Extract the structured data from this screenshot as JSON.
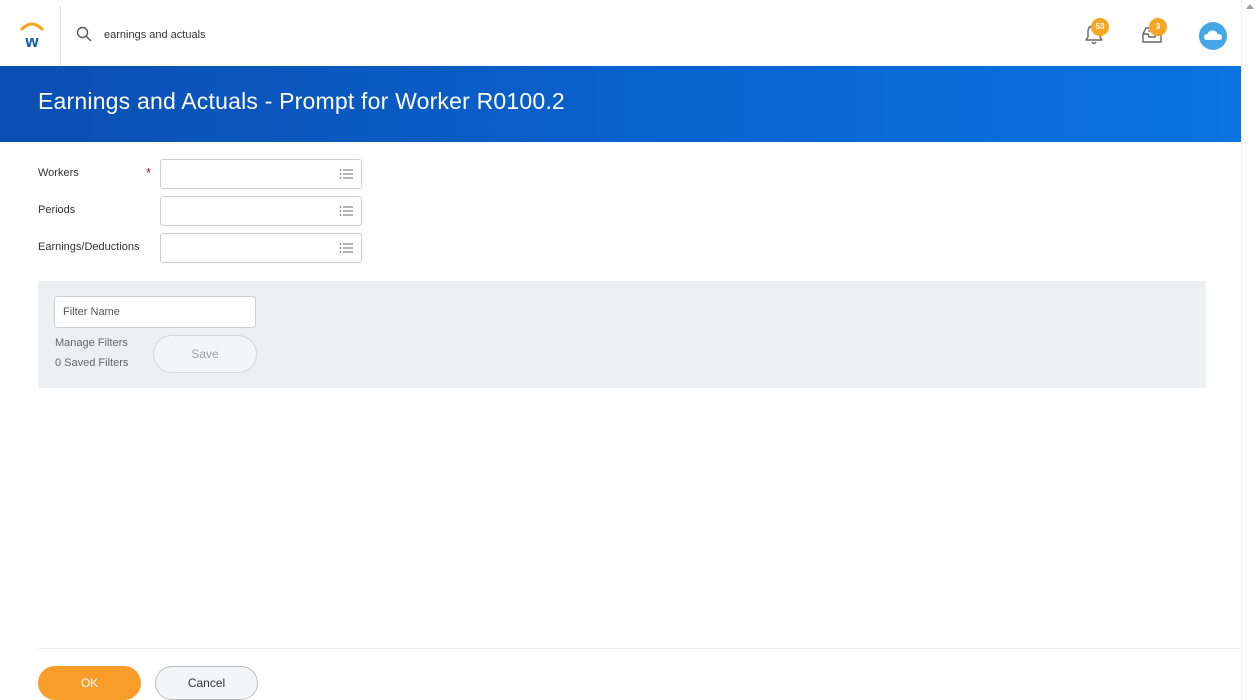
{
  "header": {
    "search_value": "earnings and actuals",
    "notifications_count": "53",
    "inbox_count": "3",
    "badge_color": "#f5a623",
    "avatar_color": "#45a8e6"
  },
  "page": {
    "title": "Earnings and Actuals - Prompt for Worker R0100.2",
    "banner_color": "#0a64d0"
  },
  "form": {
    "fields": [
      {
        "label": "Workers",
        "required": true,
        "value": ""
      },
      {
        "label": "Periods",
        "required": false,
        "value": ""
      },
      {
        "label": "Earnings/Deductions",
        "required": false,
        "value": ""
      }
    ],
    "required_marker": "*"
  },
  "filters": {
    "name_placeholder": "Filter Name",
    "manage_label": "Manage Filters",
    "saved_count_label": "0 Saved Filters",
    "save_label": "Save"
  },
  "footer": {
    "ok_label": "OK",
    "cancel_label": "Cancel",
    "ok_color": "#f89c2a"
  }
}
